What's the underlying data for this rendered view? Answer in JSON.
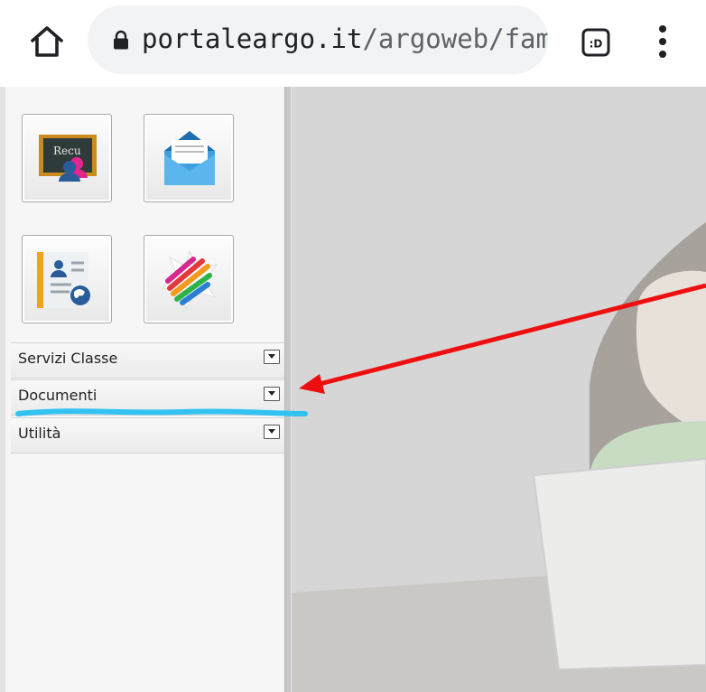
{
  "browser": {
    "url_domain": "portaleargo.it",
    "url_path": "/argoweb/fam"
  },
  "apps": [
    {
      "id": "recu",
      "label": "Recu"
    },
    {
      "id": "mail"
    },
    {
      "id": "anagrafe"
    },
    {
      "id": "colori"
    }
  ],
  "sidebar": {
    "sections": [
      {
        "label": "Servizi Classe"
      },
      {
        "label": "Documenti"
      },
      {
        "label": "Utilità"
      }
    ]
  },
  "colors": {
    "arrow": "#ee1010",
    "underline": "#33c3f0"
  }
}
